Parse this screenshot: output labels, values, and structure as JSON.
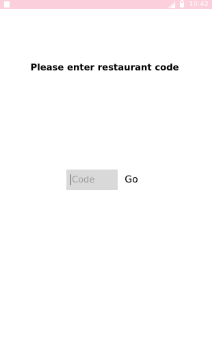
{
  "status_bar": {
    "time": "10:42",
    "background_color": "#fbd0dc",
    "icons": [
      "notification-icon",
      "signal-icon",
      "battery-icon"
    ]
  },
  "prompt": {
    "text": "Please enter restaurant code"
  },
  "code_field": {
    "value": "",
    "placeholder": "Code",
    "background_color": "#d9d9d9"
  },
  "go_button": {
    "label": "Go"
  }
}
